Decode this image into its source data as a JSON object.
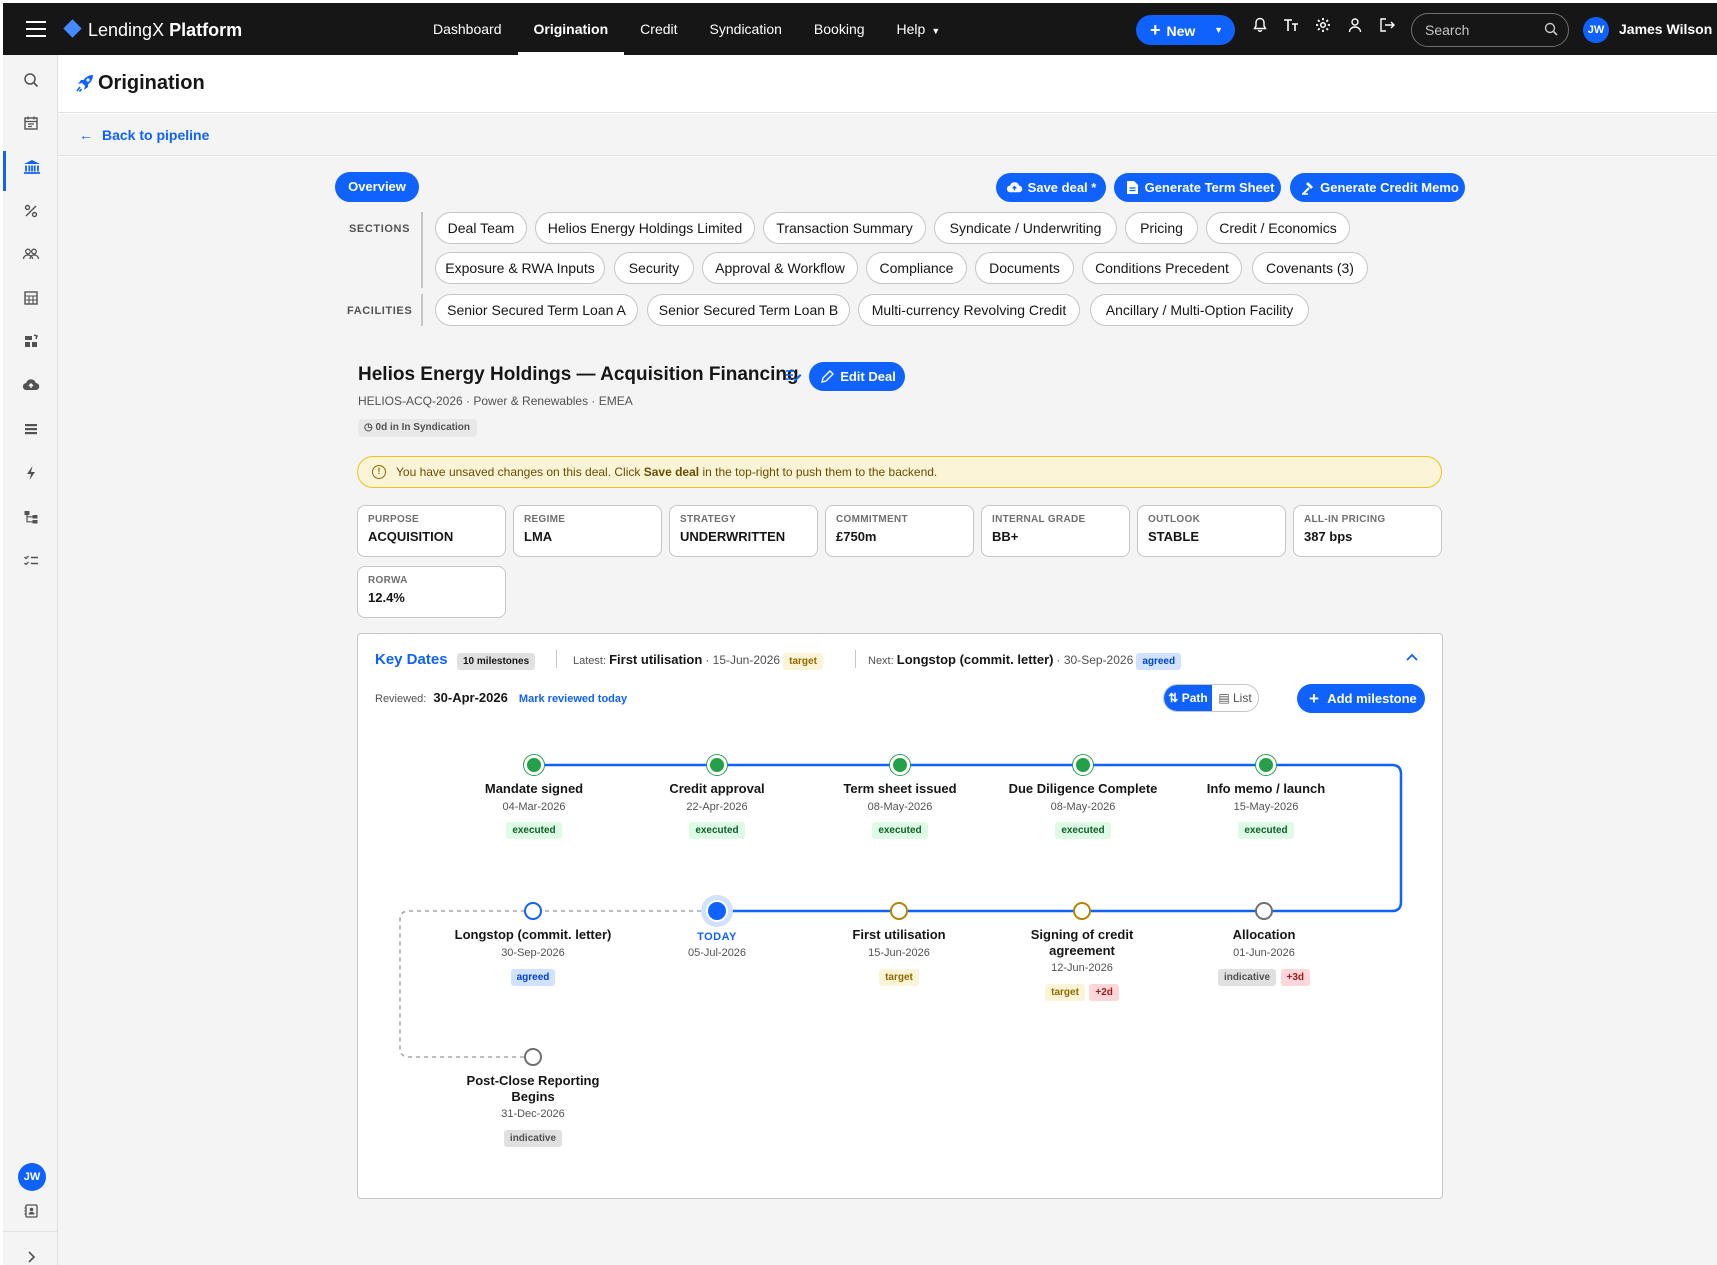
{
  "topbar": {
    "brand_light": "LendingX",
    "brand_bold": "Platform",
    "nav": [
      {
        "label": "Dashboard"
      },
      {
        "label": "Origination"
      },
      {
        "label": "Credit"
      },
      {
        "label": "Syndication"
      },
      {
        "label": "Booking"
      },
      {
        "label": "Help"
      }
    ],
    "new_label": "New",
    "search_placeholder": "Search",
    "user_initials": "JW",
    "user_name": "James Wilson"
  },
  "page": {
    "title": "Origination",
    "back_label": "Back to pipeline"
  },
  "overview_label": "Overview",
  "actions": {
    "save": "Save deal *",
    "term_sheet": "Generate Term Sheet",
    "credit_memo": "Generate Credit Memo"
  },
  "sections_label": "SECTIONS",
  "sections": [
    "Deal Team",
    "Helios Energy Holdings Limited",
    "Transaction Summary",
    "Syndicate / Underwriting",
    "Pricing",
    "Credit / Economics",
    "Exposure & RWA Inputs",
    "Security",
    "Approval & Workflow",
    "Compliance",
    "Documents",
    "Conditions Precedent",
    "Covenants (3)"
  ],
  "facilities_label": "FACILITIES",
  "facilities": [
    "Senior Secured Term Loan A",
    "Senior Secured Term Loan B",
    "Multi-currency Revolving Credit",
    "Ancillary / Multi-Option Facility"
  ],
  "deal": {
    "title": "Helios Energy Holdings — Acquisition Financing",
    "edit_label": "Edit Deal",
    "subtitle": "HELIOS-ACQ-2026 · Power & Renewables · EMEA",
    "status_tag": "0d in In Syndication",
    "warning_pre": "You have unsaved changes on this deal. Click ",
    "warning_bold": "Save deal",
    "warning_post": " in the top-right to push them to the backend."
  },
  "stats": [
    {
      "k": "PURPOSE",
      "v": "ACQUISITION"
    },
    {
      "k": "REGIME",
      "v": "LMA"
    },
    {
      "k": "STRATEGY",
      "v": "UNDERWRITTEN"
    },
    {
      "k": "COMMITMENT",
      "v": "£750m"
    },
    {
      "k": "INTERNAL GRADE",
      "v": "BB+"
    },
    {
      "k": "OUTLOOK",
      "v": "STABLE"
    },
    {
      "k": "ALL-IN PRICING",
      "v": "387 bps"
    },
    {
      "k": "RORWA",
      "v": "12.4%"
    }
  ],
  "key_dates": {
    "title": "Key Dates",
    "count": "10 milestones",
    "latest_label": "Latest:",
    "latest_name": "First utilisation",
    "latest_date": "· 15-Jun-2026",
    "latest_chip": "target",
    "next_label": "Next:",
    "next_name": "Longstop (commit. letter)",
    "next_date": "· 30-Sep-2026",
    "next_chip": "agreed",
    "reviewed_label": "Reviewed:",
    "reviewed_date": "30-Apr-2026",
    "mark_reviewed": "Mark reviewed today",
    "view_path": "Path",
    "view_list": "List",
    "add_milestone": "Add milestone",
    "today_label": "TODAY",
    "today_date": "05-Jul-2026",
    "milestones": [
      {
        "name": "Mandate signed",
        "date": "04-Mar-2026",
        "chip": "executed"
      },
      {
        "name": "Credit approval",
        "date": "22-Apr-2026",
        "chip": "executed"
      },
      {
        "name": "Term sheet issued",
        "date": "08-May-2026",
        "chip": "executed"
      },
      {
        "name": "Due Diligence Complete",
        "date": "08-May-2026",
        "chip": "executed"
      },
      {
        "name": "Info memo / launch",
        "date": "15-May-2026",
        "chip": "executed"
      },
      {
        "name": "Allocation",
        "date": "01-Jun-2026",
        "chip": "indicative",
        "delta": "+3d"
      },
      {
        "name": "Signing of credit agreement",
        "date": "12-Jun-2026",
        "chip": "target",
        "delta": "+2d"
      },
      {
        "name": "First utilisation",
        "date": "15-Jun-2026",
        "chip": "target"
      },
      {
        "name": "Longstop (commit. letter)",
        "date": "30-Sep-2026",
        "chip": "agreed"
      },
      {
        "name": "Post-Close Reporting Begins",
        "date": "31-Dec-2026",
        "chip": "indicative"
      }
    ]
  },
  "colors": {
    "accent": "#0f62fe",
    "topbar": "#161616",
    "executed": "#24a148",
    "target": "#b28600",
    "warning_bg": "#fcf4d6"
  }
}
